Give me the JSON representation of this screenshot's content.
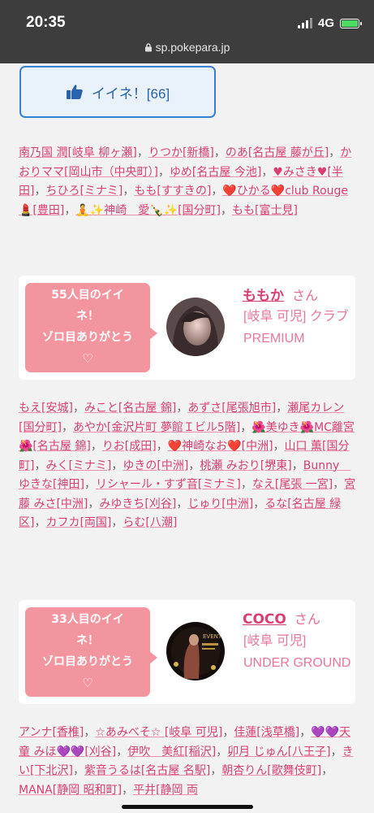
{
  "status": {
    "time": "20:35",
    "network": "4G",
    "url": "sp.pokepara.jp"
  },
  "like_button": {
    "label": "イイネ！[66]"
  },
  "list1": [
    {
      "t": "南乃国 潤[岐阜 柳ヶ瀬]"
    },
    {
      "t": "りつか[新橋]"
    },
    {
      "t": "のあ[名古屋 藤が丘]"
    },
    {
      "t": "かおりママ[岡山市（中央町）]"
    },
    {
      "t": "ゆめ[名古屋 今池]"
    },
    {
      "t": "♥みさき♥[半田]"
    },
    {
      "t": "ちひろ[ミナミ]"
    },
    {
      "t": "もも[すすきの]"
    },
    {
      "t": "❤️ひかる❤️club Rouge💄[豊田]"
    },
    {
      "t": "🧘✨神崎　愛🍾✨[国分町]"
    },
    {
      "t": "もも[富士見]"
    }
  ],
  "card1": {
    "bubble_line1": "55人目のイイ",
    "bubble_line2": "ネ！",
    "bubble_line3": "ゾロ目ありがとう",
    "bubble_line4": "♡",
    "name": "ももか",
    "san": "さん",
    "shop": "[岐阜 可児] クラブPREMIUM"
  },
  "list2": [
    {
      "t": "もえ[安城]"
    },
    {
      "t": "みこと[名古屋 錦]"
    },
    {
      "t": "あずさ[尾張旭市]"
    },
    {
      "t": "瀬尾カレン[国分町]"
    },
    {
      "t": "あやか[金沢片町 夢館Ｉビル5階]"
    },
    {
      "t": "🌺美ゆき🌺MC離宮🌺[名古屋 錦]"
    },
    {
      "t": "りお[成田]"
    },
    {
      "t": "❤️神崎なお❤️[中洲]"
    },
    {
      "t": "山口 薫[国分町]"
    },
    {
      "t": "みく[ミナミ]"
    },
    {
      "t": "ゆきの[中洲]"
    },
    {
      "t": "桃瀬 みおり[堺東]"
    },
    {
      "t": "Bunny　ゆきな[神田]"
    },
    {
      "t": "リシャール・すず音[ミナミ]"
    },
    {
      "t": "なえ[尾張 一宮]"
    },
    {
      "t": "宮藤 みさ[中洲]"
    },
    {
      "t": "みゆきち[刈谷]"
    },
    {
      "t": "じゅり[中洲]"
    },
    {
      "t": "るな[名古屋 緑区]"
    },
    {
      "t": "カフカ[両国]"
    },
    {
      "t": "らむ[八潮]"
    }
  ],
  "card2": {
    "bubble_line1": "33人目のイイ",
    "bubble_line2": "ネ！",
    "bubble_line3": "ゾロ目ありがとう",
    "bubble_line4": "♡",
    "name": "COCO",
    "san": "さん",
    "shop": "[岐阜 可児] UNDER GROUND"
  },
  "list3": [
    {
      "t": "アンナ[香椎]"
    },
    {
      "t": "☆あみべそ☆ [岐阜 可児]"
    },
    {
      "t": "佳蓮[浅草橋]"
    },
    {
      "t": "💜💜天童 みほ💜💜[刈谷]"
    },
    {
      "t": "伊吹　美紅[稲沢]"
    },
    {
      "t": "卯月 じゅん[八王子]"
    },
    {
      "t": "きい[下北沢]"
    },
    {
      "t": "紫音うるは[名古屋 名駅]"
    },
    {
      "t": "朝杏りん[歌舞伎町]"
    },
    {
      "t": "MANA[静岡 昭和町]"
    },
    {
      "t": "平井[静岡 両"
    }
  ],
  "colors": {
    "accent": "#d83f74",
    "bubble": "#f3959f",
    "like_border": "#3a7fd0"
  }
}
